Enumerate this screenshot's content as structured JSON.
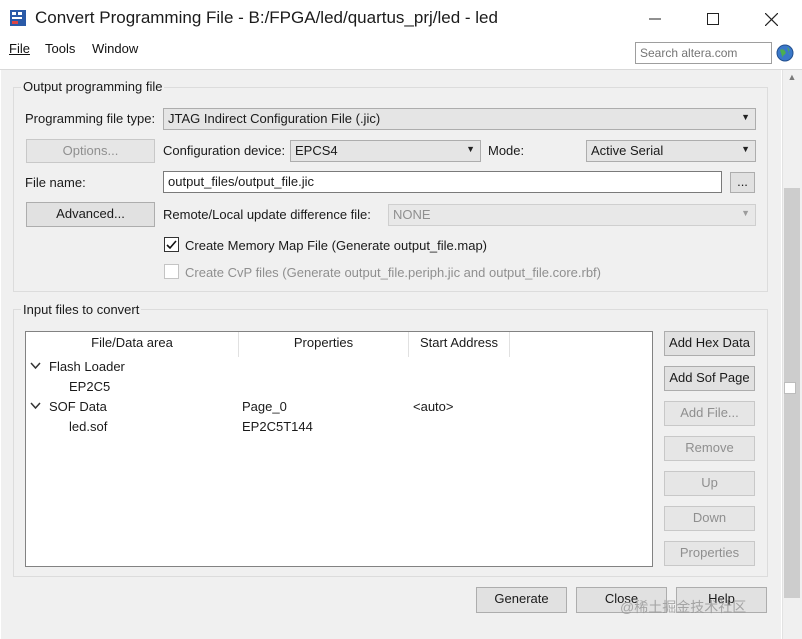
{
  "window": {
    "title": "Convert Programming File - B:/FPGA/led/quartus_prj/led - led"
  },
  "menu": {
    "file": "File",
    "tools": "Tools",
    "window": "Window"
  },
  "search": {
    "placeholder": "Search altera.com"
  },
  "output_group": {
    "title": "Output programming file",
    "file_type_label": "Programming file type:",
    "file_type_value": "JTAG Indirect Configuration File (.jic)",
    "options_button": "Options...",
    "config_device_label": "Configuration device:",
    "config_device_value": "EPCS4",
    "mode_label": "Mode:",
    "mode_value": "Active Serial",
    "file_name_label": "File name:",
    "file_name_value": "output_files/output_file.jic",
    "browse_button": "...",
    "advanced_button": "Advanced...",
    "remote_local_label": "Remote/Local update difference file:",
    "remote_local_value": "NONE",
    "memory_map_checkbox": "Create Memory Map File (Generate output_file.map)",
    "memory_map_checked": true,
    "cvp_checkbox": "Create CvP files (Generate output_file.periph.jic and output_file.core.rbf)",
    "cvp_checked": false
  },
  "input_group": {
    "title": "Input files to convert",
    "columns": [
      "File/Data area",
      "Properties",
      "Start Address"
    ],
    "rows": [
      {
        "name": "Flash Loader",
        "properties": "",
        "start_address": ""
      },
      {
        "name": "EP2C5",
        "properties": "",
        "start_address": ""
      },
      {
        "name": "SOF Data",
        "properties": "Page_0",
        "start_address": "<auto>"
      },
      {
        "name": "led.sof",
        "properties": "EP2C5T144",
        "start_address": ""
      }
    ],
    "buttons": {
      "add_hex": "Add Hex Data",
      "add_sof": "Add Sof Page",
      "add_file": "Add File...",
      "remove": "Remove",
      "up": "Up",
      "down": "Down",
      "properties": "Properties"
    }
  },
  "footer": {
    "generate": "Generate",
    "close": "Close",
    "help": "Help"
  },
  "watermark": "@稀土掘金技术社区",
  "icons": {
    "app": "quartus-app-icon",
    "globe": "globe-icon",
    "expand": "chevron-down-icon"
  }
}
